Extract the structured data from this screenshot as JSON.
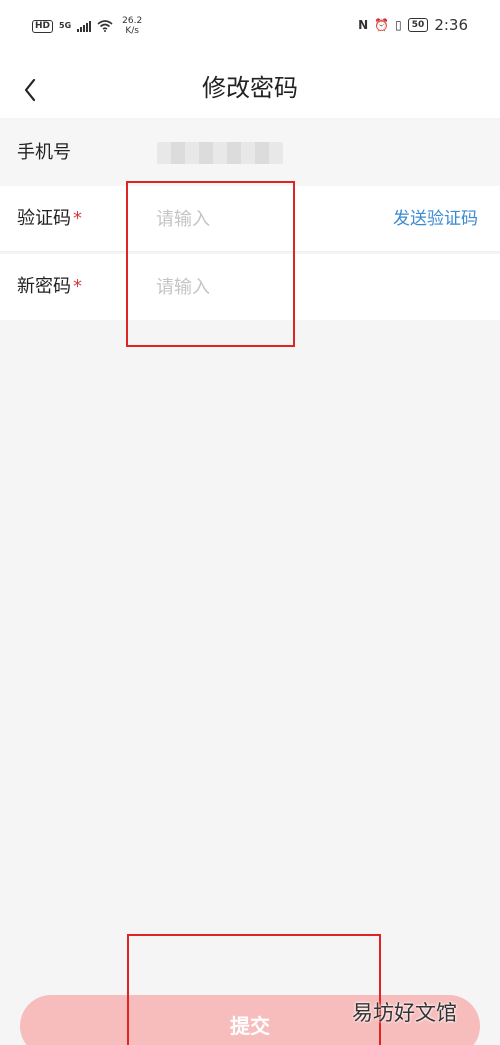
{
  "status_bar": {
    "hd": "HD",
    "network": "5G",
    "speed_value": "26.2",
    "speed_unit": "K/s",
    "nfc": "N",
    "battery": "50",
    "time": "2:36"
  },
  "header": {
    "title": "修改密码"
  },
  "form": {
    "phone_label": "手机号",
    "code_label": "验证码",
    "code_placeholder": "请输入",
    "send_code": "发送验证码",
    "password_label": "新密码",
    "password_placeholder": "请输入",
    "required_mark": "*"
  },
  "submit_label": "提交",
  "watermark": "易坊好文馆",
  "colors": {
    "accent_link": "#3a8ad2",
    "submit_bg": "#f7bcbc",
    "required": "#d63a3a",
    "annotation": "#e02424"
  }
}
